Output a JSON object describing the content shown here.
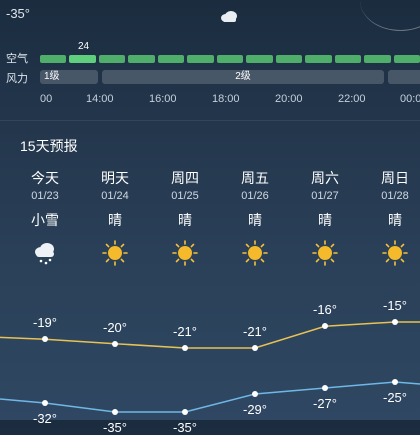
{
  "top": {
    "temp": "-35°"
  },
  "air_quality": {
    "label": "空气",
    "peak_value": "24"
  },
  "wind": {
    "label": "风力",
    "level1": "1级",
    "level2": "2级"
  },
  "times": [
    "00",
    "14:00",
    "16:00",
    "18:00",
    "20:00",
    "22:00",
    "00:0"
  ],
  "forecast": {
    "title": "15天预报",
    "days": [
      {
        "day": "今天",
        "date": "01/23",
        "cond": "小雪",
        "icon": "snow-cloud-icon",
        "high": "-19°",
        "low": "-32°",
        "high_val": -19,
        "low_val": -32
      },
      {
        "day": "明天",
        "date": "01/24",
        "cond": "晴",
        "icon": "sun-icon",
        "high": "-20°",
        "low": "-35°",
        "high_val": -20,
        "low_val": -35
      },
      {
        "day": "周四",
        "date": "01/25",
        "cond": "晴",
        "icon": "sun-icon",
        "high": "-21°",
        "low": "-35°",
        "high_val": -21,
        "low_val": -35
      },
      {
        "day": "周五",
        "date": "01/26",
        "cond": "晴",
        "icon": "sun-icon",
        "high": "-21°",
        "low": "-29°",
        "high_val": -21,
        "low_val": -29
      },
      {
        "day": "周六",
        "date": "01/27",
        "cond": "晴",
        "icon": "sun-icon",
        "high": "-16°",
        "low": "-27°",
        "high_val": -16,
        "low_val": -27
      },
      {
        "day": "周日",
        "date": "01/28",
        "cond": "晴",
        "icon": "sun-icon",
        "high": "-15°",
        "low": "-25°",
        "high_val": -15,
        "low_val": -25
      }
    ]
  },
  "colors": {
    "high_line": "#e8c255",
    "low_line": "#6fb8e6",
    "aq_green": "#4fae6a"
  }
}
